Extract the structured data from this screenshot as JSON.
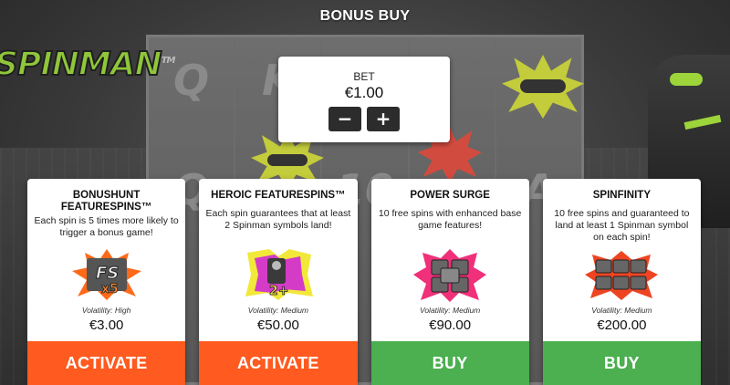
{
  "title": "BONUS BUY",
  "background": {
    "logo_text": "SPINMAN",
    "logo_tm": "TM",
    "reel_glyphs": [
      "Q",
      "K",
      "",
      "",
      "",
      "Q",
      "",
      "10",
      "",
      "A"
    ]
  },
  "bet": {
    "label": "BET",
    "value": "€1.00",
    "decrease_label": "−",
    "increase_label": "+"
  },
  "cards": [
    {
      "title": "BONUSHUNT FEATURESPINS™",
      "description": "Each spin is 5 times more likely to trigger a bonus game!",
      "icon": "fs-x5-icon",
      "volatility": "Volatility: High",
      "price": "€3.00",
      "action": "ACTIVATE",
      "action_color": "#ff5a1f"
    },
    {
      "title": "HEROIC FEATURESPINS™",
      "description": "Each spin guarantees that at least 2 Spinman symbols land!",
      "icon": "two-plus-spinman-icon",
      "volatility": "Volatility: Medium",
      "price": "€50.00",
      "action": "ACTIVATE",
      "action_color": "#ff5a1f"
    },
    {
      "title": "POWER SURGE",
      "description": "10 free spins with enhanced base game features!",
      "icon": "power-surge-icon",
      "volatility": "Volatility: Medium",
      "price": "€90.00",
      "action": "BUY",
      "action_color": "#4caf50"
    },
    {
      "title": "SPINFINITY",
      "description": "10 free spins and guaranteed to land at least 1 Spinman symbol on each spin!",
      "icon": "spinfinity-icon",
      "volatility": "Volatility: Medium",
      "price": "€200.00",
      "action": "BUY",
      "action_color": "#4caf50"
    }
  ]
}
